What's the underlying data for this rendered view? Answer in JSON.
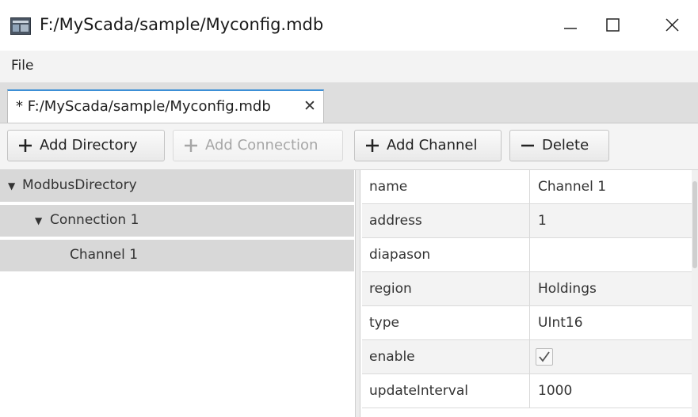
{
  "window": {
    "title": "F:/MyScada/sample/Myconfig.mdb",
    "app_icon": "app-window-icon",
    "controls": [
      "minimize-icon",
      "maximize-icon",
      "close-icon"
    ]
  },
  "menu": {
    "file": "File"
  },
  "tab": {
    "label": "* F:/MyScada/sample/Myconfig.mdb",
    "close": "✕"
  },
  "toolbar": {
    "add_directory": "Add Directory",
    "add_connection": "Add Connection",
    "add_channel": "Add Channel",
    "delete": "Delete"
  },
  "tree": {
    "directory": "ModbusDirectory",
    "connection": "Connection 1",
    "channel": "Channel 1"
  },
  "properties": [
    {
      "name": "name",
      "value": "Channel 1"
    },
    {
      "name": "address",
      "value": "1"
    },
    {
      "name": "diapason",
      "value": ""
    },
    {
      "name": "region",
      "value": "Holdings"
    },
    {
      "name": "type",
      "value": "UInt16"
    },
    {
      "name": "enable",
      "value": true
    },
    {
      "name": "updateInterval",
      "value": "1000"
    }
  ],
  "colors": {
    "tab_accent": "#3c8fd6",
    "tree_selection": "#d8d8d8"
  }
}
